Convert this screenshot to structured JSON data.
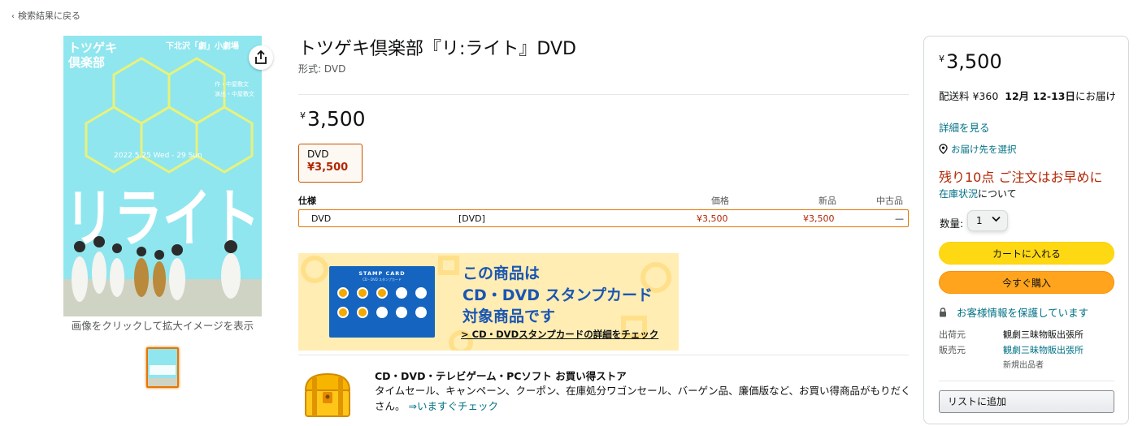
{
  "nav": {
    "back_label": "検索結果に戻る"
  },
  "image": {
    "caption": "画像をクリックして拡大イメージを表示",
    "poster_text": {
      "logo_line1": "トツゲキ",
      "logo_line2": "倶楽部",
      "venue": "下北沢「劇」小劇場",
      "credits_line1": "作・中屋敷文",
      "credits_line2": "演出・中屋敷文",
      "dates": "2022.5.25 Wed - 29 Sun",
      "big_title": "リライト"
    }
  },
  "product": {
    "title": "トツゲキ倶楽部『リ:ライト』DVD",
    "format_line": "形式: DVD",
    "currency": "¥",
    "price": "3,500",
    "format_option": {
      "name": "DVD",
      "price": "¥3,500"
    }
  },
  "spec_table": {
    "headers": {
      "spec": "仕様",
      "price": "価格",
      "new": "新品",
      "used": "中古品"
    },
    "row": {
      "name": "DVD",
      "format": "[DVD]",
      "price": "¥3,500",
      "new": "¥3,500",
      "used": "—"
    }
  },
  "stamp_banner": {
    "card_title": "STAMP CARD",
    "card_sub": "CD・DVD スタンプカード",
    "line1": "この商品は",
    "line2": "CD・DVD スタンプカード",
    "line3": "対象商品です",
    "link": "> CD・DVDスタンプカードの詳細をチェック"
  },
  "store_promo": {
    "title": "CD・DVD・テレビゲーム・PCソフト お買い得ストア",
    "desc": "タイムセール、キャンペーン、クーポン、在庫処分ワゴンセール、バーゲン品、廉価版など、お買い得商品がもりだくさん。",
    "link": "⇒いますぐチェック"
  },
  "buybox": {
    "currency": "¥",
    "price": "3,500",
    "shipping_prefix": "配送料 ¥360",
    "delivery_date": "12月 12-13日",
    "delivery_suffix": "にお届け",
    "details_link": "詳細を見る",
    "location_link": "お届け先を選択",
    "stock_warning": "残り10点 ご注文はお早めに",
    "stock_status_link": "在庫状況",
    "stock_status_suffix": "について",
    "qty_label": "数量:",
    "qty_value": "1",
    "add_to_cart": "カートに入れる",
    "buy_now": "今すぐ購入",
    "secure": "お客様情報を保護しています",
    "ships_from_label": "出荷元",
    "ships_from": "観劇三昧物販出張所",
    "sold_by_label": "販売元",
    "sold_by": "観劇三昧物販出張所",
    "new_sellers": "新規出品者",
    "add_to_list": "リストに追加"
  },
  "colors": {
    "link": "#007185",
    "price_red": "#b12704",
    "accent_orange": "#e77600",
    "cart_yellow": "#ffd814",
    "buy_orange": "#ffa41c",
    "poster_cyan": "#8fe6ee",
    "banner_blue": "#1a56b3"
  }
}
